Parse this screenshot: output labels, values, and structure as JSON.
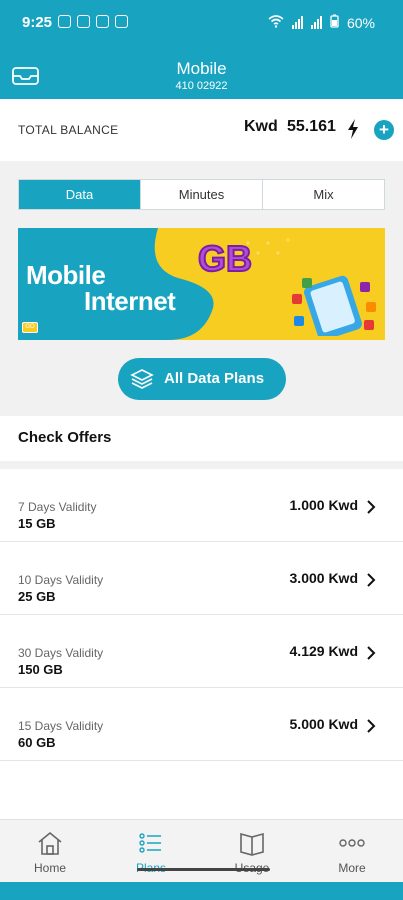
{
  "status": {
    "time": "9:25",
    "battery": "60%"
  },
  "header": {
    "title": "Mobile",
    "subtitle": "410 02922"
  },
  "balance": {
    "label": "TOTAL BALANCE",
    "currency": "Kwd",
    "value": "55.161"
  },
  "tabs": [
    "Data",
    "Minutes",
    "Mix"
  ],
  "active_tab": "Data",
  "banner": {
    "line1": "Mobile",
    "line2": "Internet",
    "badge": "GB",
    "tag": "GO"
  },
  "all_data_button": "All Data Plans",
  "offers": {
    "title": "Check Offers",
    "items": [
      {
        "validity": "7 Days Validity",
        "data": "15 GB",
        "price": "1.000 Kwd"
      },
      {
        "validity": "10 Days Validity",
        "data": "25 GB",
        "price": "3.000 Kwd"
      },
      {
        "validity": "30 Days Validity",
        "data": "150 GB",
        "price": "4.129 Kwd"
      },
      {
        "validity": "15 Days Validity",
        "data": "60 GB",
        "price": "5.000 Kwd"
      }
    ]
  },
  "nav": [
    {
      "label": "Home",
      "icon": "home-icon"
    },
    {
      "label": "Plans",
      "icon": "list-icon"
    },
    {
      "label": "Usage",
      "icon": "book-icon"
    },
    {
      "label": "More",
      "icon": "more-dots-icon"
    }
  ],
  "active_nav": "Plans",
  "colors": {
    "accent": "#18a4c0",
    "banner_yellow": "#f7cd22"
  }
}
